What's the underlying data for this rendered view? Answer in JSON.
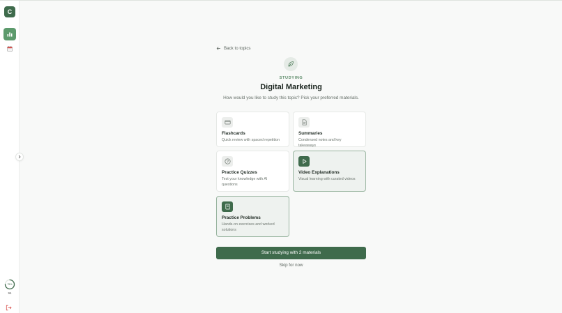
{
  "sidebar": {
    "logo_letter": "C",
    "nav_items": [
      {
        "icon": "chart-icon",
        "active": true
      },
      {
        "icon": "calendar-icon",
        "active": false
      }
    ],
    "progress_label": "75%",
    "progress_fraction": 0.75,
    "streak": "94",
    "logout_icon": "logout-icon",
    "collapse_icon": "chevron-right-icon"
  },
  "main": {
    "back_link": "Back to topics",
    "hero_icon": "leaf-icon",
    "eyebrow": "STUDYING",
    "title": "Digital Marketing",
    "subtitle": "How would you like to study this topic? Pick your preferred materials.",
    "options": [
      {
        "id": "flashcards",
        "title": "Flashcards",
        "description": "Quick review with spaced repetition",
        "icon": "card-icon",
        "selected": false
      },
      {
        "id": "summaries",
        "title": "Summaries",
        "description": "Condensed notes and key takeaways",
        "icon": "document-icon",
        "selected": false
      },
      {
        "id": "quizzes",
        "title": "Practice Quizzes",
        "description": "Test your knowledge with AI questions",
        "icon": "question-icon",
        "selected": false
      },
      {
        "id": "videos",
        "title": "Video Explanations",
        "description": "Visual learning with curated videos",
        "icon": "play-icon",
        "selected": true
      },
      {
        "id": "problems",
        "title": "Practice Problems",
        "description": "Hands-on exercises and worked solutions",
        "icon": "book-icon",
        "selected": true
      }
    ],
    "start_button": "Start studying with 2 materials",
    "skip_link": "Skip for now"
  },
  "colors": {
    "accent": "#3f6b4c",
    "accent_light": "#5c9a6c",
    "selected_bg": "#eef2ef",
    "selected_border": "#99b5a0"
  }
}
